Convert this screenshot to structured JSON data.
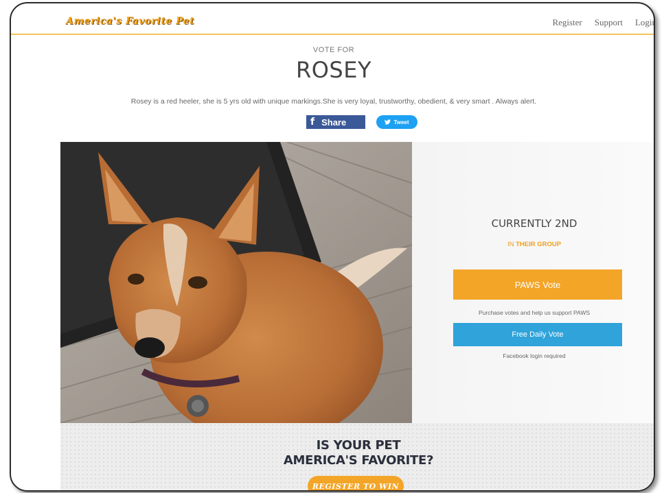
{
  "header": {
    "logo": "America's Favorite Pet",
    "nav": [
      "Register",
      "Support",
      "Login"
    ]
  },
  "hero": {
    "vote_for": "VOTE FOR",
    "pet_name": "ROSEY",
    "description": "Rosey is a red heeler, she is 5 yrs old with unique markings.She is very loyal, trustworthy, obedient, & very smart . Always alert.",
    "share_label": "Share",
    "tweet_label": "Tweet"
  },
  "panel": {
    "rank": "CURRENTLY 2ND",
    "group_prefix": "IN",
    "group_highlight": "THEIR GROUP",
    "paws_vote_label": "PAWS Vote",
    "paws_note": "Purchase votes and help us support PAWS",
    "free_vote_label": "Free Daily Vote",
    "free_note": "Facebook login required"
  },
  "promo": {
    "title_line1": "IS YOUR PET",
    "title_line2": "AMERICA'S FAVORITE?",
    "cta": "REGISTER TO WIN"
  },
  "colors": {
    "accent_orange": "#f3a528",
    "facebook_blue": "#3b5998",
    "twitter_blue": "#1da1f2",
    "vote_blue": "#2fa3da"
  }
}
